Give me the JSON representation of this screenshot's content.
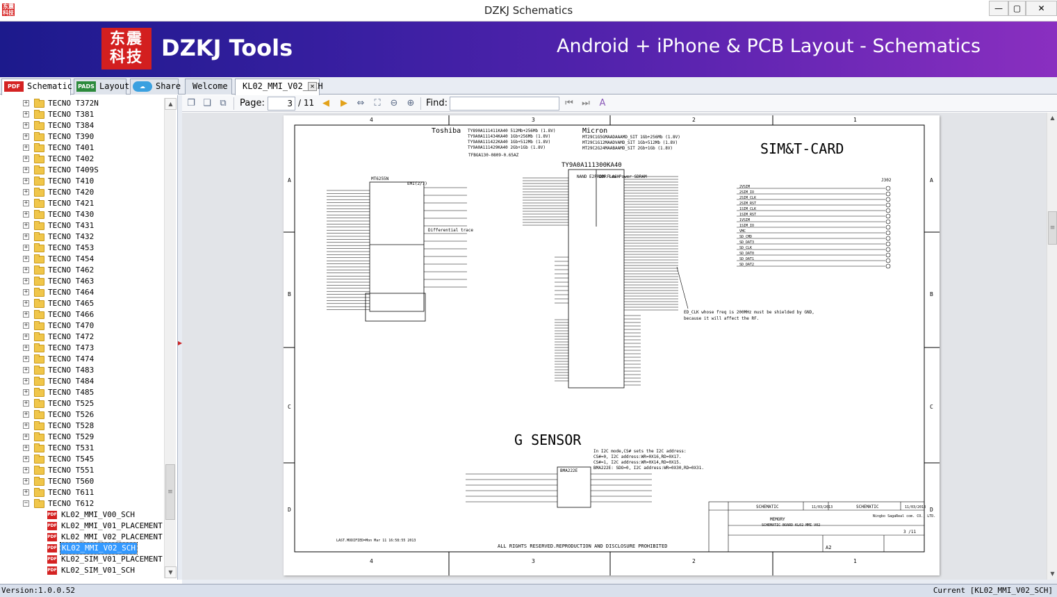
{
  "window": {
    "title": "DZKJ Schematics",
    "minimize": "—",
    "maximize": "▢",
    "close": "✕"
  },
  "banner": {
    "logo_text": "东震科技",
    "brand": "DZKJ Tools",
    "tagline": "Android + iPhone & PCB Layout - Schematics"
  },
  "left_tabs": [
    {
      "label": "Schematic",
      "icon": "PDF"
    },
    {
      "label": "Layout",
      "icon": "PADS"
    },
    {
      "label": "Share",
      "icon": "share-icon"
    }
  ],
  "doc_tabs": [
    {
      "label": "Welcome"
    },
    {
      "label": "KL02_MMI_V02_SCH"
    }
  ],
  "tree": {
    "folders": [
      "TECNO T372N",
      "TECNO T381",
      "TECNO T384",
      "TECNO T390",
      "TECNO T401",
      "TECNO T402",
      "TECNO T409S",
      "TECNO T410",
      "TECNO T420",
      "TECNO T421",
      "TECNO T430",
      "TECNO T431",
      "TECNO T432",
      "TECNO T453",
      "TECNO T454",
      "TECNO T462",
      "TECNO T463",
      "TECNO T464",
      "TECNO T465",
      "TECNO T466",
      "TECNO T470",
      "TECNO T472",
      "TECNO T473",
      "TECNO T474",
      "TECNO T483",
      "TECNO T484",
      "TECNO T485",
      "TECNO T525",
      "TECNO T526",
      "TECNO T528",
      "TECNO T529",
      "TECNO T531",
      "TECNO T545",
      "TECNO T551",
      "TECNO T560",
      "TECNO T611"
    ],
    "open_folder": "TECNO T612",
    "files": [
      "KL02_MMI_V00_SCH",
      "KL02_MMI_V01_PLACEMENT",
      "KL02_MMI_V02_PLACEMENT",
      "KL02_MMI_V02_SCH",
      "KL02_SIM_V01_PLACEMENT",
      "KL02_SIM_V01_SCH"
    ],
    "selected_file_index": 3
  },
  "viewer": {
    "page_label": "Page:",
    "page_value": "3",
    "page_total": "/ 11",
    "find_label": "Find:",
    "find_value": ""
  },
  "schematic": {
    "col_labels": [
      "4",
      "3",
      "2",
      "1"
    ],
    "row_labels": [
      "A",
      "B",
      "C",
      "D"
    ],
    "title_sim": "SIM&T-CARD",
    "title_gsensor": "G SENSOR",
    "vendor_toshiba": "Toshiba",
    "vendor_micron": "Micron",
    "toshiba_parts": [
      "TY890A111411KA40 512Mb+256Mb (1.8V)",
      "TY9A0A111434KA40 1Gb+256Mb (1.8V)",
      "TY9A0A111422KA40 1Gb+512Mb (1.8V)",
      "TY9A0A111429KA40 2Gb+1Gb (1.8V)"
    ],
    "micron_parts": [
      "MT29C1G5GMAADAAAMD_SIT 1Gb+256Mb (1.8V)",
      "MT29C1G12MAADVAMD_SIT 1Gb+512Mb (1.8V)",
      "MT29C2G24MAABAAMD_SIT 2Gb+1Gb (1.8V)"
    ],
    "package": "TFBGA130-0809-0.65AZ",
    "mem_part": "TY9A0A111300KA40",
    "chip_mt": "MT6255N",
    "chip_emi": "EMI(2/7)",
    "nand_label": "NAND E2PROM FLASH",
    "ddr_label": "DDR Low Power SDRAM",
    "diff_trace": "Differential trace",
    "ed_clk_note": "ED_CLK whose freq is 200MHz must be shielded by GND,",
    "ed_clk_note2": "because it will affect the RF.",
    "i2c_note": "In I2C mode,CS# sets the I2C address:",
    "i2c_line1": "CS#=0, I2C address:WR=0X16,RD=0X17.",
    "i2c_line2": "CS#=1, I2C address:WR=0X14,RD=0X15.",
    "i2c_line3": "BMA222E: SDO=0, I2C address:WR=0X30,RD=0X31.",
    "bma_chip": "BMA222E",
    "sim_connector": "J302",
    "sim_nets": [
      "2VSIM",
      "2SIM_IO",
      "2SIM_CLK",
      "2SIM_RST",
      "1SIM_CLK",
      "1SIM_RST",
      "1VSIM",
      "1SIM_IO"
    ],
    "tcard_nets": [
      "VMC",
      "SD_CMD",
      "SD_DAT3",
      "SD_CLK",
      "SD_DAT0",
      "SD_DAT1",
      "SD_DAT2"
    ],
    "footer": "ALL RIGHTS RESERVED.REPRODUCTION AND DISCLOSURE PROHIBITED",
    "tb_title": "MEMORY",
    "tb_product": "SCHEMATIC BOARD KL02 MMI V02",
    "tb_company": "Ningbo SagaReal com. CO., LTD.",
    "tb_sheet": "3 /11",
    "tb_format": "A2",
    "tb_date": "11/03/2013",
    "tb_name": "SCHEMATIC",
    "last_modified": "LAST.MODIFIED=Mon Mar 11 16:58:55 2013"
  },
  "status": {
    "version": "Version:1.0.0.52",
    "current": "Current [KL02_MMI_V02_SCH]"
  }
}
